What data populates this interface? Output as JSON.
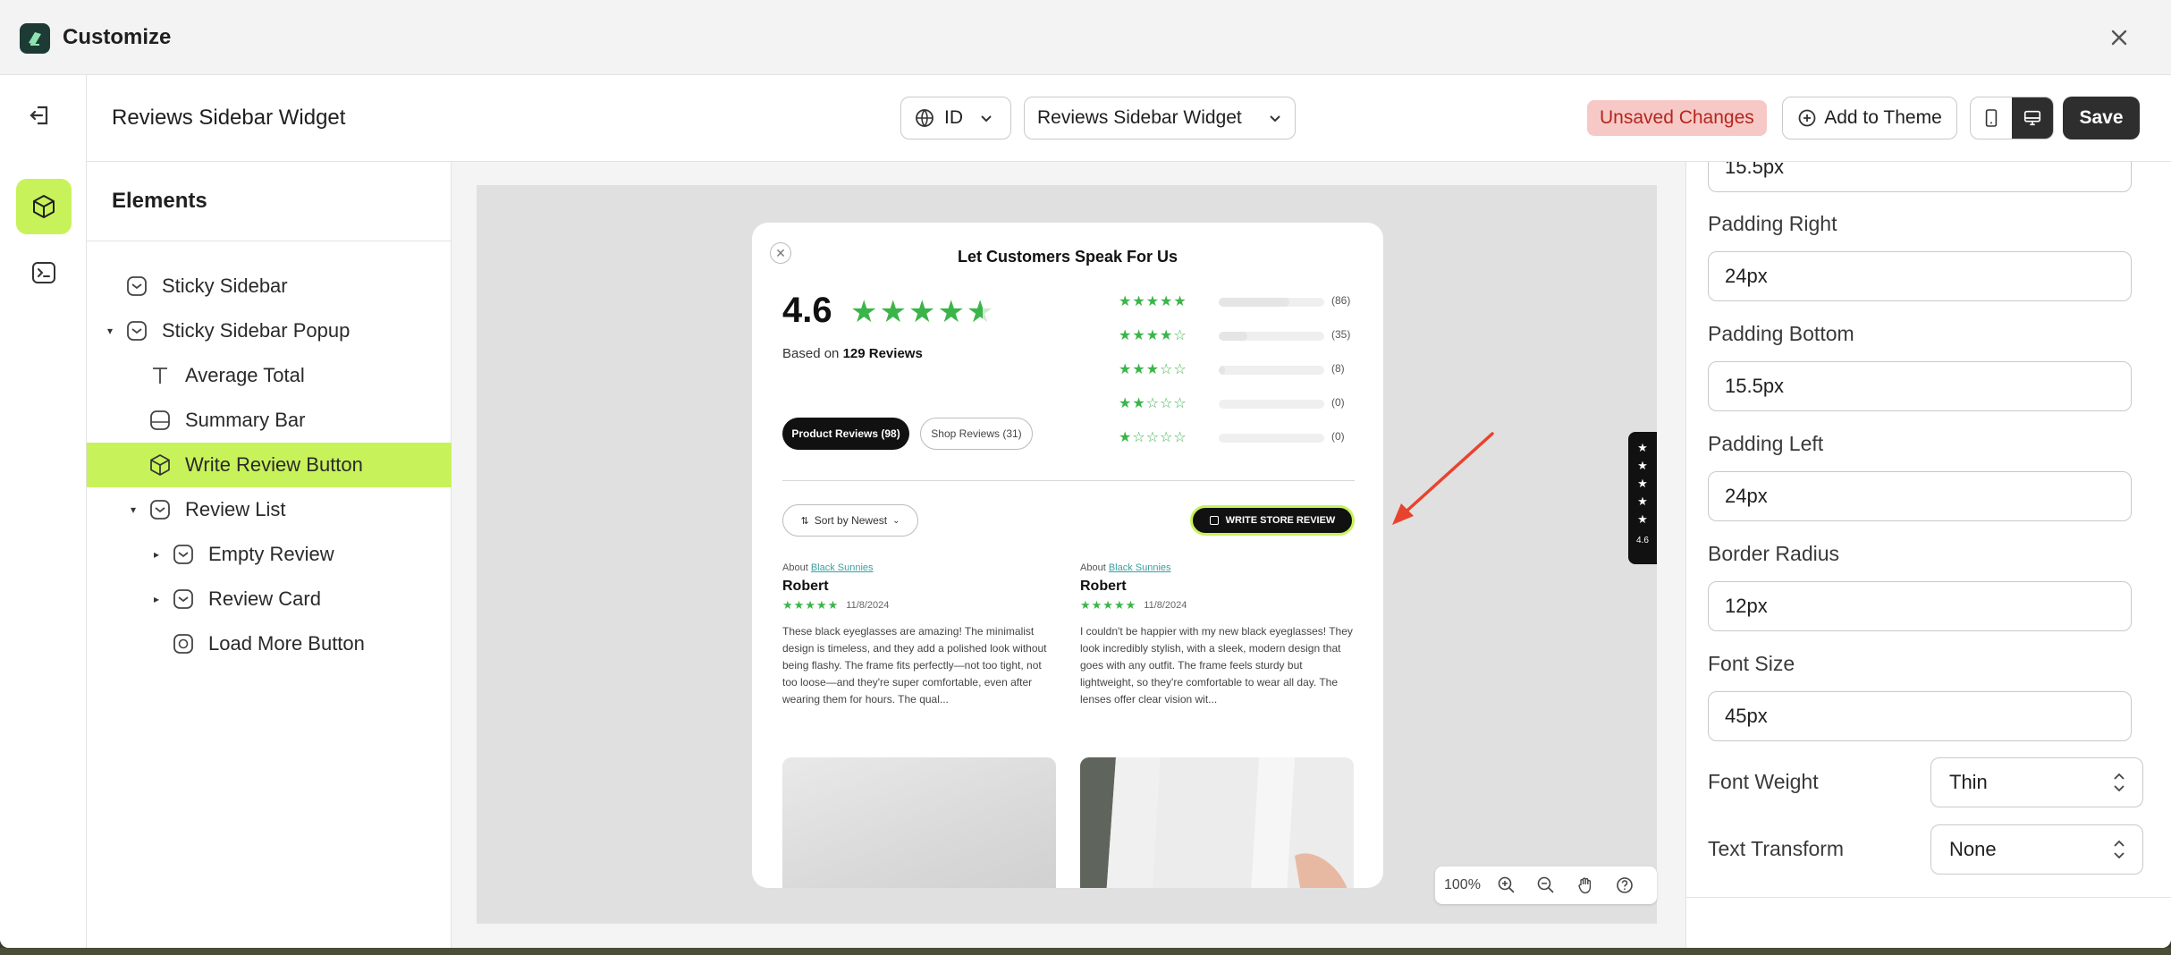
{
  "window": {
    "title": "Customize"
  },
  "header": {
    "page_title": "Reviews Sidebar Widget",
    "language": "ID",
    "widget_select": "Reviews Sidebar Widget",
    "unsaved": "Unsaved Changes",
    "add_to_theme": "Add to Theme",
    "save": "Save"
  },
  "elements": {
    "heading": "Elements",
    "items": [
      {
        "label": "Sticky Sidebar"
      },
      {
        "label": "Sticky Sidebar Popup"
      },
      {
        "label": "Average Total"
      },
      {
        "label": "Summary Bar"
      },
      {
        "label": "Write Review Button"
      },
      {
        "label": "Review List"
      },
      {
        "label": "Empty Review"
      },
      {
        "label": "Review Card"
      },
      {
        "label": "Load More Button"
      }
    ]
  },
  "preview": {
    "title": "Let Customers Speak For Us",
    "average": "4.6",
    "based_on_prefix": "Based on ",
    "based_on_count": "129 Reviews",
    "distribution": [
      {
        "stars": 5,
        "count": "(86)",
        "fraction": 0.67
      },
      {
        "stars": 4,
        "count": "(35)",
        "fraction": 0.27
      },
      {
        "stars": 3,
        "count": "(8)",
        "fraction": 0.06
      },
      {
        "stars": 2,
        "count": "(0)",
        "fraction": 0
      },
      {
        "stars": 1,
        "count": "(0)",
        "fraction": 0
      }
    ],
    "tab_product": "Product Reviews (98)",
    "tab_shop": "Shop Reviews (31)",
    "sort": "Sort by Newest",
    "write_button": "WRITE STORE REVIEW",
    "reviews": [
      {
        "about_prefix": "About ",
        "about_link": "Black Sunnies",
        "name": "Robert",
        "date": "11/8/2024",
        "body": "These black eyeglasses are amazing! The minimalist design is timeless, and they add a polished look without being flashy. The frame fits perfectly—not too tight, not too loose—and they're super comfortable, even after wearing them for hours. The qual..."
      },
      {
        "about_prefix": "About ",
        "about_link": "Black Sunnies",
        "name": "Robert",
        "date": "11/8/2024",
        "body": "I couldn't be happier with my new black eyeglasses! They look incredibly stylish, with a sleek, modern design that goes with any outfit. The frame feels sturdy but lightweight, so they're comfortable to wear all day. The lenses offer clear vision wit..."
      }
    ],
    "side_tab_rating": "4.6",
    "zoom": "100%"
  },
  "properties": {
    "top_value": "15.5px",
    "padding_right_label": "Padding Right",
    "padding_right": "24px",
    "padding_bottom_label": "Padding Bottom",
    "padding_bottom": "15.5px",
    "padding_left_label": "Padding Left",
    "padding_left": "24px",
    "border_radius_label": "Border Radius",
    "border_radius": "12px",
    "font_size_label": "Font Size",
    "font_size": "45px",
    "font_weight_label": "Font Weight",
    "font_weight": "Thin",
    "text_transform_label": "Text Transform",
    "text_transform": "None"
  },
  "colors": {
    "accent": "#c8f25a",
    "star": "#3bb54a",
    "unsaved_bg": "#f7c9c6",
    "unsaved_text": "#b3261e",
    "dark": "#2e2e2e",
    "annotation_arrow": "#e8432e"
  }
}
